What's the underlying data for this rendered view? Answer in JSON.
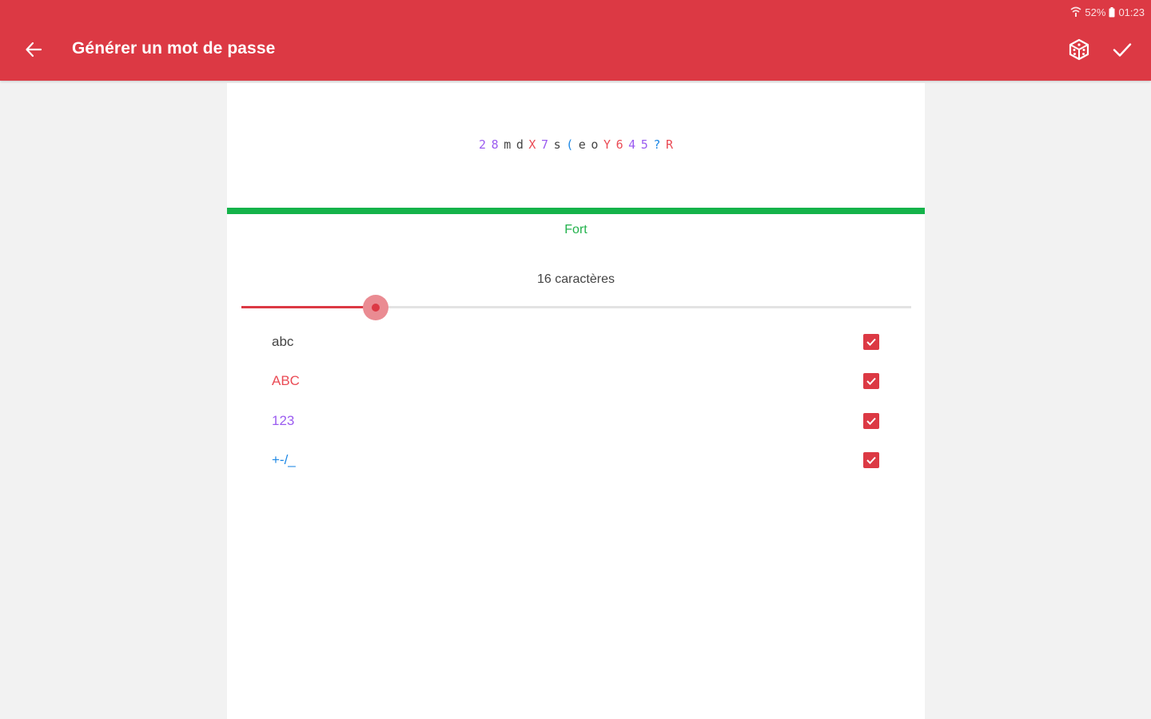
{
  "status_bar": {
    "battery": "52%",
    "time": "01:23"
  },
  "header": {
    "title": "Générer un mot de passe"
  },
  "password": {
    "chars": [
      {
        "c": "2",
        "color": "#9b5cf0"
      },
      {
        "c": "8",
        "color": "#9b5cf0"
      },
      {
        "c": "m",
        "color": "#444444"
      },
      {
        "c": "d",
        "color": "#444444"
      },
      {
        "c": "X",
        "color": "#ea4b55"
      },
      {
        "c": "7",
        "color": "#9b5cf0"
      },
      {
        "c": "s",
        "color": "#444444"
      },
      {
        "c": "(",
        "color": "#1e88e5"
      },
      {
        "c": "e",
        "color": "#444444"
      },
      {
        "c": "o",
        "color": "#444444"
      },
      {
        "c": "Y",
        "color": "#ea4b55"
      },
      {
        "c": "6",
        "color": "#ea4b55"
      },
      {
        "c": "4",
        "color": "#9b5cf0"
      },
      {
        "c": "5",
        "color": "#9b5cf0"
      },
      {
        "c": "?",
        "color": "#1e88e5"
      },
      {
        "c": "R",
        "color": "#ea4b55"
      }
    ]
  },
  "strength": {
    "label": "Fort",
    "level": 1.0,
    "color": "#14b34a"
  },
  "length": {
    "label": "16 caractères",
    "slider_fraction": 0.2
  },
  "options": [
    {
      "label": "abc",
      "color": "#444444",
      "checked": true
    },
    {
      "label": "ABC",
      "color": "#ea4b55",
      "checked": true
    },
    {
      "label": "123",
      "color": "#9b5cf0",
      "checked": true
    },
    {
      "label": "+-/_",
      "color": "#1e88e5",
      "checked": true
    }
  ],
  "colors": {
    "accent": "#dc3944",
    "background": "#f2f2f2"
  }
}
